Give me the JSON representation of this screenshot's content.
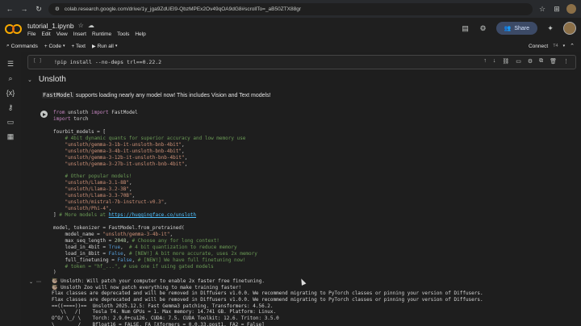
{
  "browser": {
    "url": "colab.research.google.com/drive/1y_jga9ZdUEl9-QbzMPEx2Ov49qOA9dG8#scrollTo=_aB50ZTX88gr",
    "icons": [
      "back-arrow-icon",
      "forward-arrow-icon",
      "reload-icon",
      "site-info-icon",
      "bookmark-star-icon",
      "extension-icon",
      "profile-avatar"
    ]
  },
  "header": {
    "file_name": "tutorial_1.ipynb",
    "menu": [
      "File",
      "Edit",
      "View",
      "Insert",
      "Runtime",
      "Tools",
      "Help"
    ],
    "share_label": "Share"
  },
  "toolbar": {
    "commands_label": "Commands",
    "code_label": "+ Code",
    "text_label": "+ Text",
    "run_all_label": "Run all",
    "connect_label": "Connect",
    "runtime_badge": "T4"
  },
  "notebook": {
    "pip_line": "!pip install --no-deps trl==0.22.2",
    "pip_bracket": "[ ]",
    "section_title": "Unsloth",
    "md_mono": "FastModel",
    "md_rest": " supports loading nearly any model now! This includes Vision and Text models!",
    "code_lines": [
      "from unsloth import FastModel",
      "import torch",
      "",
      "fourbit_models = [",
      "    # 4bit dynamic quants for superior accuracy and low memory use",
      "    \"unsloth/gemma-3-1b-it-unsloth-bnb-4bit\",",
      "    \"unsloth/gemma-3-4b-it-unsloth-bnb-4bit\",",
      "    \"unsloth/gemma-3-12b-it-unsloth-bnb-4bit\",",
      "    \"unsloth/gemma-3-27b-it-unsloth-bnb-4bit\",",
      "",
      "    # Other popular models!",
      "    \"unsloth/Llama-3.1-8B\",",
      "    \"unsloth/Llama-3.2-3B\",",
      "    \"unsloth/Llama-3.3-70B\",",
      "    \"unsloth/mistral-7b-instruct-v0.3\",",
      "    \"unsloth/Phi-4\",",
      "] # More models at https://huggingface.co/unsloth",
      "",
      "model, tokenizer = FastModel.from_pretrained(",
      "    model_name = \"unsloth/gemma-3-4b-it\",",
      "    max_seq_length = 2048, # Choose any for long context!",
      "    load_in_4bit = True,  # 4 bit quantization to reduce memory",
      "    load_in_8bit = False, # [NEW!] A bit more accurate, uses 2x memory",
      "    full_finetuning = False, # [NEW!] We have full finetuning now!",
      "    # token = \"hf_...\", # use one if using gated models",
      ")"
    ],
    "output_lines": [
      "🦥 Unsloth: Will patch your computer to enable 2x faster free finetuning.",
      "🦥 Unsloth Zoo will now patch everything to make training faster!",
      "Flax classes are deprecated and will be removed in Diffusers v1.0.0. We recommend migrating to PyTorch classes or pinning your version of Diffusers.",
      "Flax classes are deprecated and will be removed in Diffusers v1.0.0. We recommend migrating to PyTorch classes or pinning your version of Diffusers.",
      "==((====))==  Unsloth 2025.12.5: Fast Gemma3 patching. Transformers: 4.56.2.",
      "   \\\\   /|    Tesla T4. Num GPUs = 1. Max memory: 14.741 GB. Platform: Linux.",
      "O^O/ \\_/ \\    Torch: 2.9.0+cu126. CUDA: 7.5. CUDA Toolkit: 12.6. Triton: 3.5.0",
      "\\        /    Bfloat16 = FALSE. FA [Xformers = 0.0.33.post1. FA2 = False]"
    ]
  }
}
